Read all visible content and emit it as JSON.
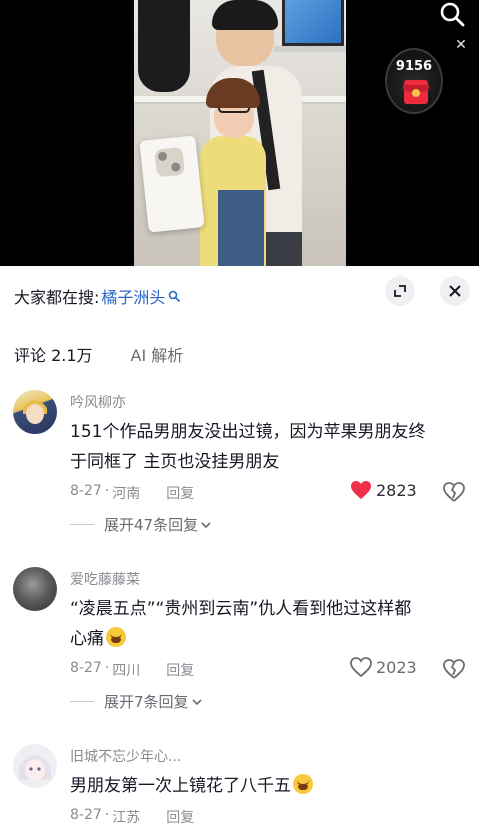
{
  "video": {
    "redpacket_count": "9156",
    "icons": {
      "search": "search-icon",
      "close": "close-icon",
      "redpacket": "red-envelope-icon"
    }
  },
  "panel": {
    "search_prefix": "大家都在搜:",
    "search_keyword": "橘子洲头",
    "tabs": [
      {
        "label": "评论 2.1万",
        "active": true
      },
      {
        "label": "AI 解析",
        "active": false
      }
    ]
  },
  "comments": [
    {
      "user": "吟风柳亦",
      "text_line1": "151个作品男朋友没出过镜，因为苹果男朋友终",
      "text_line2": "于同框了 主页也没挂男朋友",
      "date": "8-27",
      "location": "河南",
      "reply_label": "回复",
      "likes": "2823",
      "liked": true,
      "expand_label": "展开47条回复"
    },
    {
      "user": "爱吃藤藤菜",
      "text_line1": "“凌晨五点”“贵州到云南”仇人看到他过这样都",
      "text_line2": "心痛",
      "date": "8-27",
      "location": "四川",
      "reply_label": "回复",
      "likes": "2023",
      "liked": false,
      "expand_label": "展开7条回复"
    },
    {
      "user": "旧城不忘少年心...",
      "text_line1": "男朋友第一次上镜花了八千五",
      "date": "8-27",
      "location": "江苏",
      "reply_label": "回复"
    }
  ],
  "colors": {
    "accent_blue": "#2a65c9",
    "like_red": "#f0304a",
    "muted": "#8a8b91"
  }
}
